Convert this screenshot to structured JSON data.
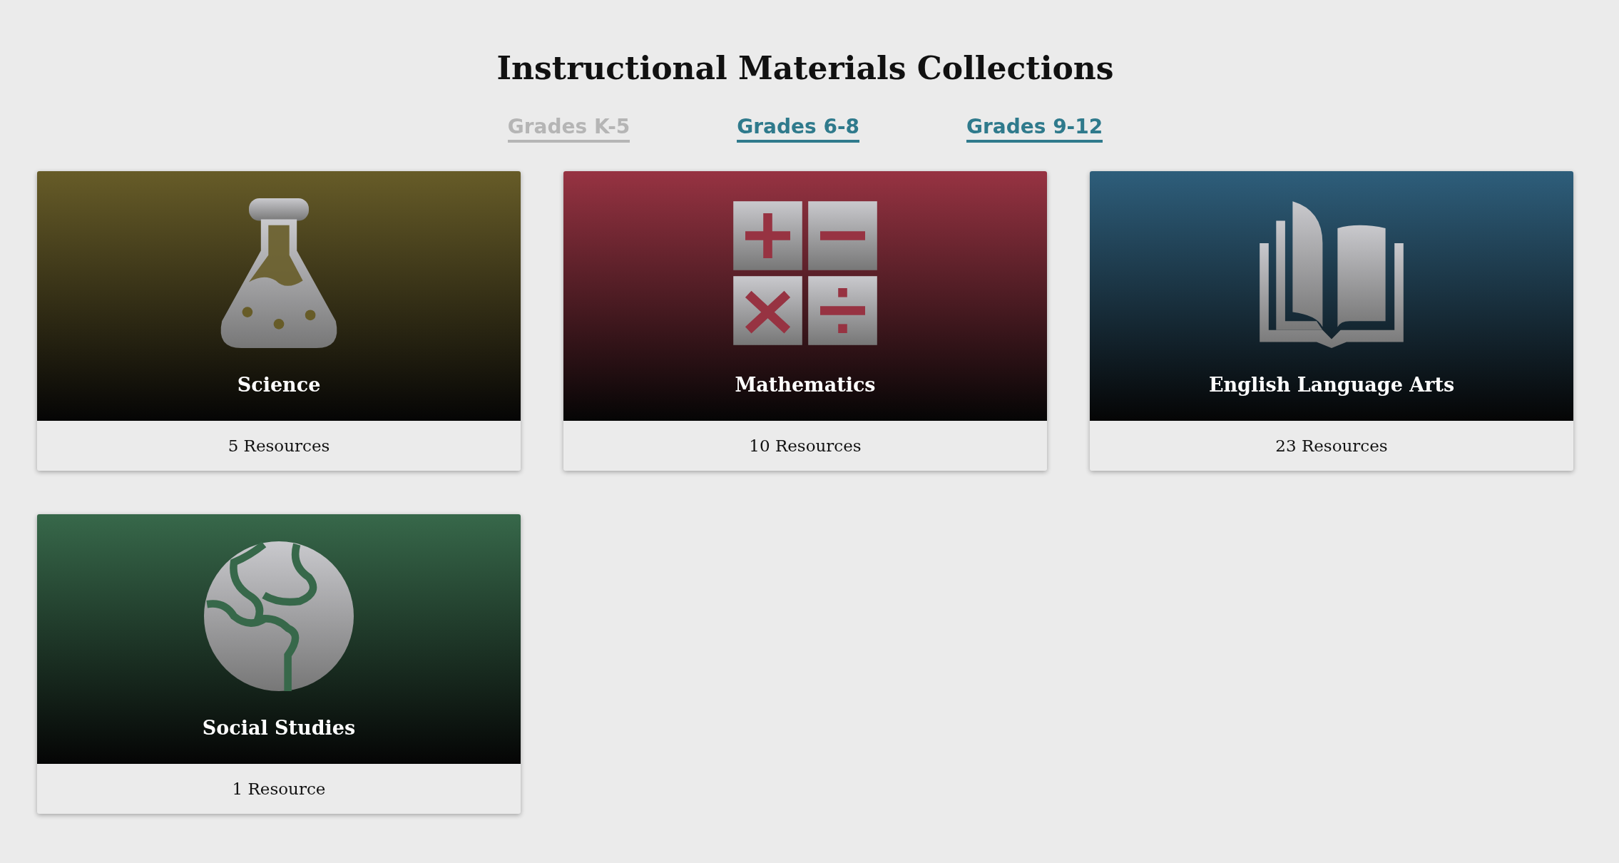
{
  "title": "Instructional Materials Collections",
  "tabs": [
    {
      "label": "Grades K-5",
      "selected": true
    },
    {
      "label": "Grades 6-8",
      "selected": false
    },
    {
      "label": "Grades 9-12",
      "selected": false
    }
  ],
  "collections": [
    {
      "kind": "flask",
      "name": "Science",
      "count": "5 Resources",
      "color": "#675c28"
    },
    {
      "kind": "calculator",
      "name": "Mathematics",
      "count": "10 Resources",
      "color": "#973342"
    },
    {
      "kind": "book",
      "name": "English Language Arts",
      "count": "23 Resources",
      "color": "#2e5e7b"
    },
    {
      "kind": "globe",
      "name": "Social Studies",
      "count": "1 Resource",
      "color": "#37684a"
    }
  ]
}
